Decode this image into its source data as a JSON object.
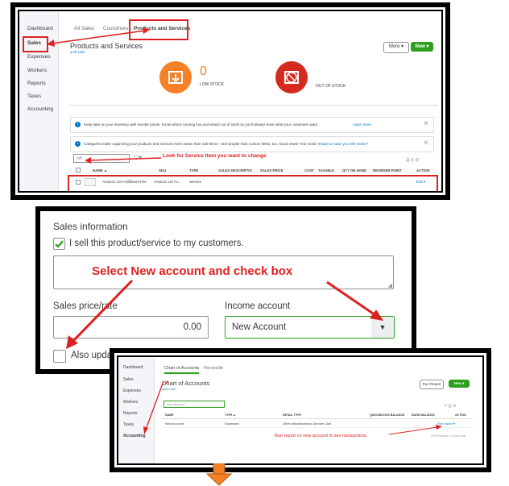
{
  "panel1": {
    "sidebar": [
      "Dashboard",
      "Sales",
      "Expenses",
      "Workers",
      "Reports",
      "Taxes",
      "Accounting"
    ],
    "tabs": [
      "All Sales",
      "Customers",
      "Products and Services"
    ],
    "page_title": "Products and Services",
    "back_link": "◂ All Lists",
    "more_button": "More ▾",
    "new_button": "New",
    "low_stock_count": "0",
    "low_stock_label": "LOW STOCK",
    "out_of_stock_label": "OUT OF STOCK",
    "banner1": "Keep tabs on your inventory with reorder points. Know what's running low and what's out of stock so you'll always have what your customers want.",
    "banner1_link": "Learn more",
    "banner2": "Categories make organizing your products and services even easier than sub-items - and simpler than custom fields, too. Good news! Your existing categories will now show up as categories, just like sub-items can make entering transactions a snap.",
    "banner2_link": "Ready to make your life easier?",
    "search_value": "biff",
    "annotation": "Look for Service Item you want to change",
    "columns": [
      "NAME ▲",
      "SKU",
      "TYPE",
      "SALES DESCRIPTION",
      "SALES PRICE",
      "COST",
      "TAXABLE",
      "QTY ON HAND",
      "REORDER POINT",
      "ACTION"
    ],
    "row": {
      "name": "Amazon US Fulfillment Fee",
      "sku": "Amazon US Fu...",
      "type": "Service",
      "action": "Edit ▾"
    }
  },
  "panel2": {
    "section_title": "Sales information",
    "checkbox_label": "I sell this product/service to my customers.",
    "annotation": "Select New account and check box",
    "price_label": "Sales price/rate",
    "price_value": "0.00",
    "income_label": "Income account",
    "income_value": "New Account",
    "also_update_label": "Also update this account in historical transactions"
  },
  "panel3": {
    "sidebar": [
      "Dashboard",
      "Sales",
      "Expenses",
      "Workers",
      "Reports",
      "Taxes",
      "Accounting"
    ],
    "tabs": [
      "Chart of Accounts",
      "Reconcile"
    ],
    "page_title": "Chart of Accounts",
    "back_link": "◂ All Lists",
    "run_report_button": "Run Report",
    "new_button": "New",
    "search_value": "new account",
    "columns": [
      "NAME",
      "TYPE ▲",
      "DETAIL TYPE",
      "QUICKBOOKS BALANCE",
      "BANK BALANCE",
      "ACTION"
    ],
    "row": {
      "name": "New Account",
      "type": "Expenses",
      "detail_type": "Other Miscellaneous Service Cost",
      "action": "Run report ▾"
    },
    "annotation": "Run report on new account to see transactions",
    "pager": "First  Previous  1-1  Next  Last"
  },
  "colors": {
    "annotation_red": "#e02020",
    "qb_green": "#2ca01c",
    "low_stock_orange": "#f58025",
    "out_of_stock_red": "#d52b1e",
    "link_blue": "#0077c5",
    "arrow_orange": "#f58025"
  }
}
